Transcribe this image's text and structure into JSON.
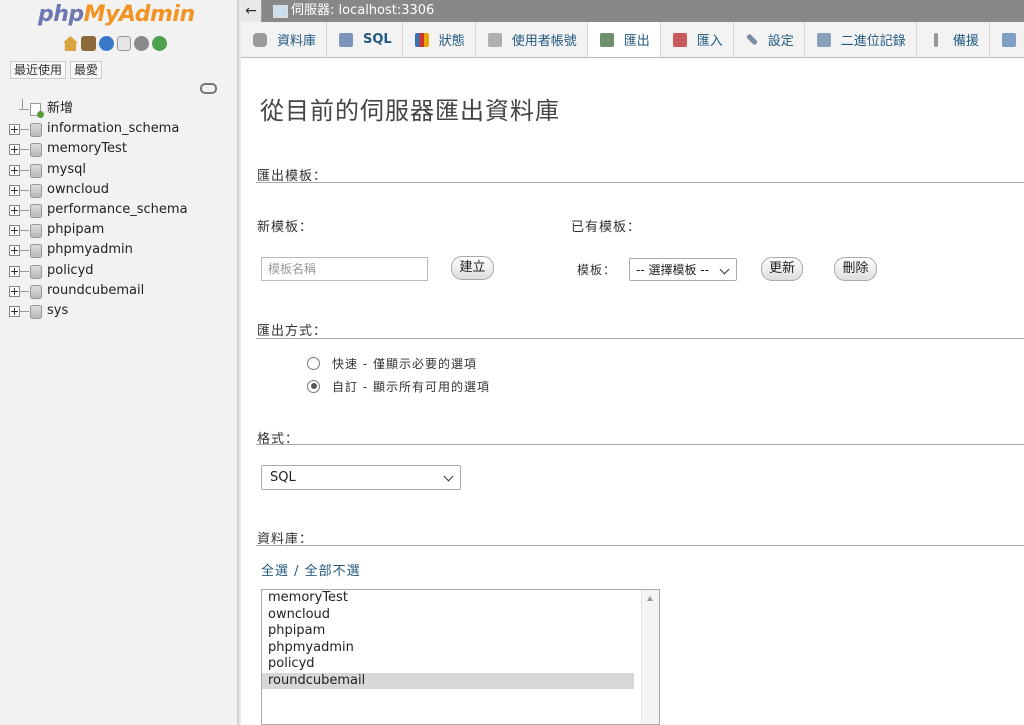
{
  "nav": {
    "logo_php": "php",
    "logo_my": "My",
    "logo_admin": "Admin",
    "icons": [
      "home-icon",
      "database-icon",
      "help-icon",
      "docs-icon",
      "settings-icon",
      "reload-icon"
    ],
    "tab_recent": "最近使用",
    "tab_favorites": "最愛",
    "new_item": "新增",
    "databases": [
      "information_schema",
      "memoryTest",
      "mysql",
      "owncloud",
      "performance_schema",
      "phpipam",
      "phpmyadmin",
      "policyd",
      "roundcubemail",
      "sys"
    ]
  },
  "topbar": {
    "server": "伺服器: localhost:3306"
  },
  "tabs": [
    {
      "label": "資料庫",
      "icon": "database-icon"
    },
    {
      "label": "SQL",
      "icon": "sql-icon"
    },
    {
      "label": "狀態",
      "icon": "status-icon"
    },
    {
      "label": "使用者帳號",
      "icon": "users-icon"
    },
    {
      "label": "匯出",
      "icon": "export-icon",
      "active": true
    },
    {
      "label": "匯入",
      "icon": "import-icon"
    },
    {
      "label": "設定",
      "icon": "wrench-icon"
    },
    {
      "label": "二進位記錄",
      "icon": "binlog-icon"
    },
    {
      "label": "備援",
      "icon": "replication-icon"
    }
  ],
  "main": {
    "title": "從目前的伺服器匯出資料庫",
    "templates": {
      "heading": "匯出模板：",
      "new_label": "新模板：",
      "name_placeholder": "模板名稱",
      "create_button": "建立",
      "existing_label": "已有模板：",
      "template_label": "模板：",
      "template_select": "-- 選擇模板 --",
      "update_button": "更新",
      "delete_button": "刪除"
    },
    "method": {
      "heading": "匯出方式：",
      "quick": "快速 - 僅顯示必要的選項",
      "custom": "自訂 - 顯示所有可用的選項",
      "selected": "custom"
    },
    "format": {
      "heading": "格式：",
      "value": "SQL"
    },
    "databases": {
      "heading": "資料庫：",
      "select_all": "全選",
      "separator": " / ",
      "deselect_all": "全部不選",
      "list": [
        "memoryTest",
        "owncloud",
        "phpipam",
        "phpmyadmin",
        "policyd",
        "roundcubemail"
      ],
      "selected": "roundcubemail"
    }
  }
}
